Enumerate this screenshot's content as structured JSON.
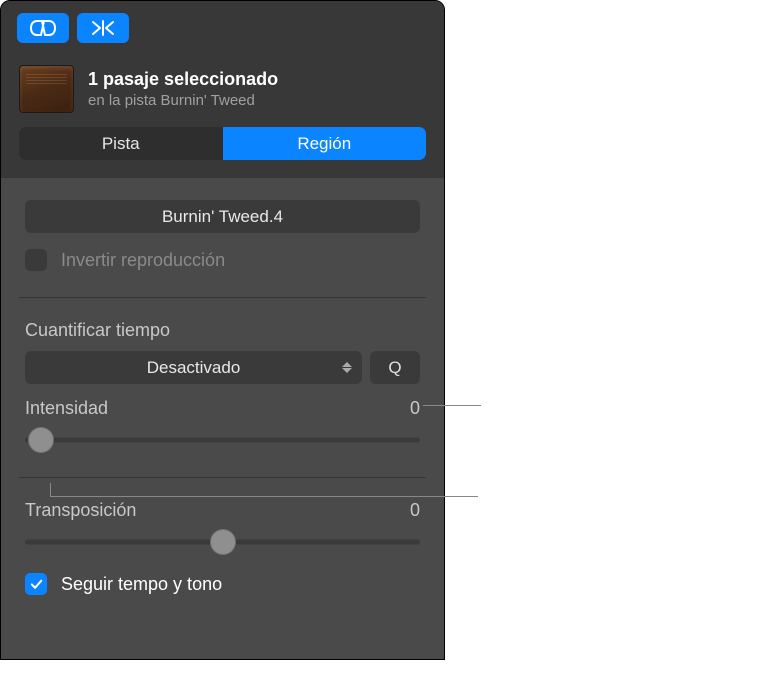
{
  "header": {
    "title": "1 pasaje seleccionado",
    "subtitle": "en la pista Burnin' Tweed"
  },
  "tabs": {
    "track": "Pista",
    "region": "Región"
  },
  "region": {
    "name": "Burnin' Tweed.4",
    "reverse_label": "Invertir reproducción"
  },
  "quantize": {
    "label": "Cuantificar tiempo",
    "value": "Desactivado",
    "q_button": "Q",
    "strength_label": "Intensidad",
    "strength_value": "0"
  },
  "transpose": {
    "label": "Transposición",
    "value": "0",
    "follow_label": "Seguir tempo y tono"
  }
}
